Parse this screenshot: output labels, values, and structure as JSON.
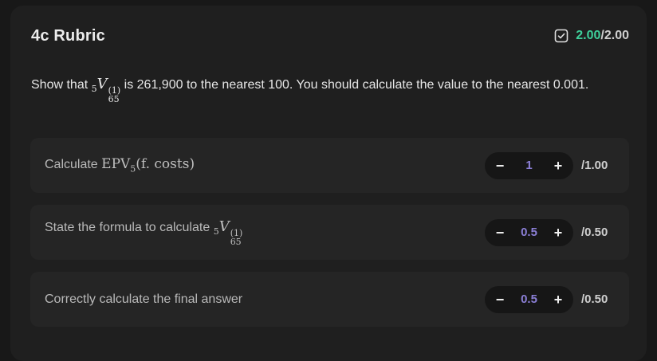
{
  "rubric": {
    "title": "4c Rubric",
    "score_earned": "2.00",
    "score_total": "/2.00",
    "accent_color": "#3ecf9a"
  },
  "question": {
    "prefix": "Show that",
    "math_pre": "5",
    "math_symbol": "V",
    "math_sup": "(1)",
    "math_sub": "65",
    "suffix": "is 261,900 to the nearest 100. You should calculate the value to the nearest 0.001."
  },
  "criteria": [
    {
      "label_text": "Calculate",
      "label_math": "EPV",
      "label_math_sub": "5",
      "label_math_tail": "(f. costs)",
      "value": "1",
      "max": "/1.00"
    },
    {
      "label_text": "State the formula to calculate",
      "label_math_pre": "5",
      "label_math_symbol": "V",
      "label_math_sup": "(1)",
      "label_math_sub": "65",
      "value": "0.5",
      "max": "/0.50"
    },
    {
      "label_text": "Correctly calculate the final answer",
      "value": "0.5",
      "max": "/0.50"
    }
  ],
  "controls": {
    "decrement_symbol": "−",
    "increment_symbol": "+"
  },
  "icons": {
    "score": "checkbox-checked-icon"
  },
  "colors": {
    "value_purple": "#8b7fd6"
  }
}
